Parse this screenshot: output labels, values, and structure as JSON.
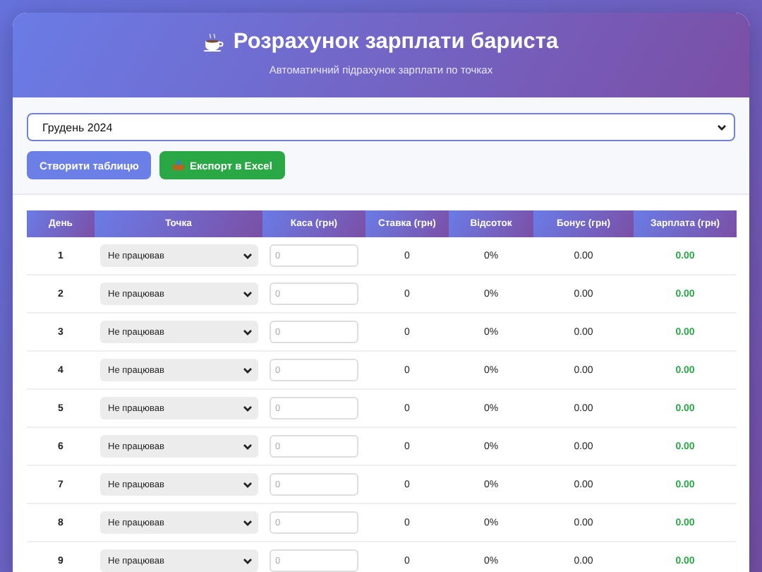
{
  "header": {
    "title": "Розрахунок зарплати бариста",
    "subtitle": "Автоматичний підрахунок зарплати по точках"
  },
  "month_select": {
    "value": "Грудень 2024"
  },
  "buttons": [
    {
      "kind": "create",
      "label": "Створити таблицю"
    },
    {
      "kind": "export",
      "label": "Експорт в Excel"
    }
  ],
  "table": {
    "columns": [
      "День",
      "Точка",
      "Каса (грн)",
      "Ставка (грн)",
      "Відсоток",
      "Бонус (грн)",
      "Зарплата (грн)"
    ],
    "rows": [
      {
        "day": "1",
        "point": "Не працював",
        "cash_placeholder": "0",
        "rate": "0",
        "percent": "0%",
        "bonus": "0.00",
        "salary": "0.00"
      },
      {
        "day": "2",
        "point": "Не працював",
        "cash_placeholder": "0",
        "rate": "0",
        "percent": "0%",
        "bonus": "0.00",
        "salary": "0.00"
      },
      {
        "day": "3",
        "point": "Не працював",
        "cash_placeholder": "0",
        "rate": "0",
        "percent": "0%",
        "bonus": "0.00",
        "salary": "0.00"
      },
      {
        "day": "4",
        "point": "Не працював",
        "cash_placeholder": "0",
        "rate": "0",
        "percent": "0%",
        "bonus": "0.00",
        "salary": "0.00"
      },
      {
        "day": "5",
        "point": "Не працював",
        "cash_placeholder": "0",
        "rate": "0",
        "percent": "0%",
        "bonus": "0.00",
        "salary": "0.00"
      },
      {
        "day": "6",
        "point": "Не працював",
        "cash_placeholder": "0",
        "rate": "0",
        "percent": "0%",
        "bonus": "0.00",
        "salary": "0.00"
      },
      {
        "day": "7",
        "point": "Не працював",
        "cash_placeholder": "0",
        "rate": "0",
        "percent": "0%",
        "bonus": "0.00",
        "salary": "0.00"
      },
      {
        "day": "8",
        "point": "Не працював",
        "cash_placeholder": "0",
        "rate": "0",
        "percent": "0%",
        "bonus": "0.00",
        "salary": "0.00"
      },
      {
        "day": "9",
        "point": "Не працював",
        "cash_placeholder": "0",
        "rate": "0",
        "percent": "0%",
        "bonus": "0.00",
        "salary": "0.00"
      }
    ]
  }
}
